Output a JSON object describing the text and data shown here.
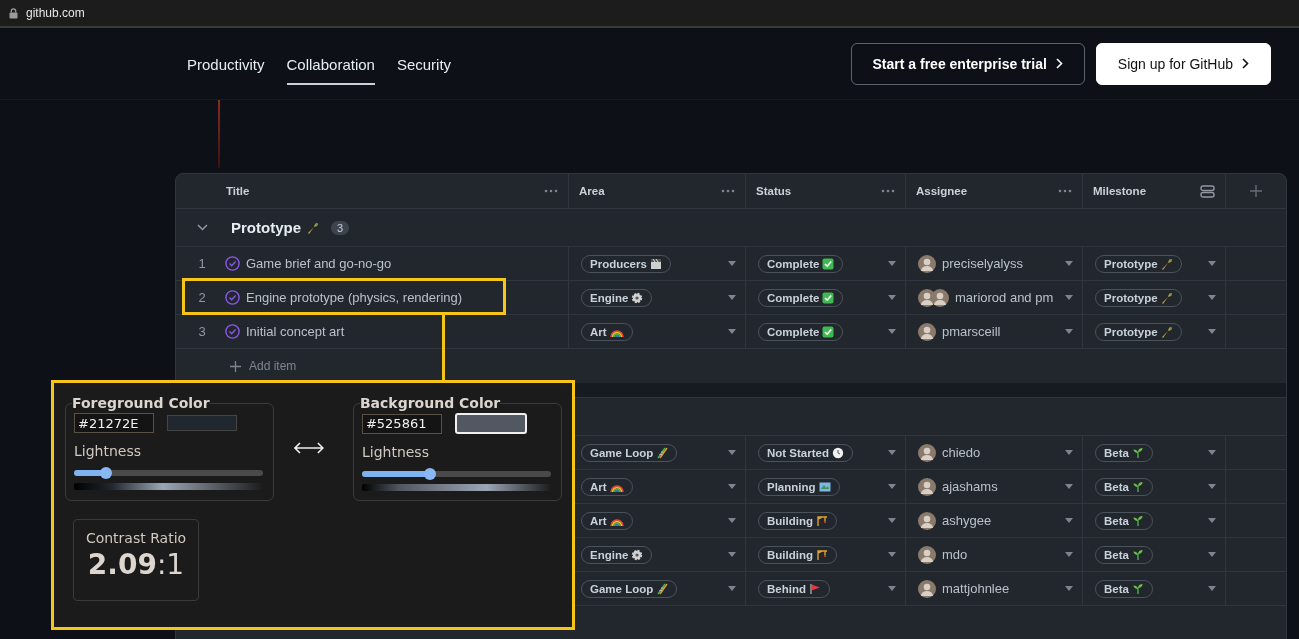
{
  "browser": {
    "address": "github.com"
  },
  "nav": {
    "links": [
      {
        "label": "Productivity",
        "selected": false
      },
      {
        "label": "Collaboration",
        "selected": true
      },
      {
        "label": "Security",
        "selected": false
      }
    ],
    "buttons": [
      {
        "label": "Start a free enterprise trial",
        "kind": "outline"
      },
      {
        "label": "Sign up for GitHub",
        "kind": "primary"
      }
    ]
  },
  "table": {
    "columns": [
      {
        "label": "Title",
        "kind": "dots"
      },
      {
        "label": "Area",
        "kind": "dots"
      },
      {
        "label": "Status",
        "kind": "dots"
      },
      {
        "label": "Assignee",
        "kind": "dots"
      },
      {
        "label": "Milestone",
        "kind": "layout"
      }
    ],
    "groups": [
      {
        "title": "Prototype",
        "kind": "bottle",
        "count": "3",
        "expanded": true,
        "add_label": "Add item",
        "rows": [
          {
            "number": "1",
            "title": "Game brief and go-no-go",
            "area": {
              "label": "Producers",
              "kind": "clapper"
            },
            "status": {
              "label": "Complete",
              "kind": "check"
            },
            "assignee": {
              "name": "preciselyalyss",
              "kind": "single"
            },
            "milestone": {
              "label": "Prototype",
              "kind": "bottle"
            }
          },
          {
            "number": "2",
            "title": "Engine prototype (physics, rendering)",
            "area": {
              "label": "Engine",
              "kind": "gear"
            },
            "status": {
              "label": "Complete",
              "kind": "check"
            },
            "assignee": {
              "name": "mariorod and pm",
              "kind": "pair"
            },
            "milestone": {
              "label": "Prototype",
              "kind": "bottle"
            }
          },
          {
            "number": "3",
            "title": "Initial concept art",
            "area": {
              "label": "Art",
              "kind": "rainbow"
            },
            "status": {
              "label": "Complete",
              "kind": "check"
            },
            "assignee": {
              "name": "pmarsceill",
              "kind": "single"
            },
            "milestone": {
              "label": "Prototype",
              "kind": "bottle"
            }
          }
        ]
      },
      {
        "rows": [
          {
            "area": {
              "label": "Game Loop",
              "kind": "slide"
            },
            "status": {
              "label": "Not Started",
              "kind": "clock"
            },
            "assignee": {
              "name": "chiedo",
              "kind": "single"
            },
            "milestone": {
              "label": "Beta",
              "kind": "sprout"
            }
          },
          {
            "area": {
              "label": "Art",
              "kind": "rainbow"
            },
            "status": {
              "label": "Planning",
              "kind": "map"
            },
            "assignee": {
              "name": "ajashams",
              "kind": "single"
            },
            "milestone": {
              "label": "Beta",
              "kind": "sprout"
            }
          },
          {
            "area": {
              "label": "Art",
              "kind": "rainbow"
            },
            "status": {
              "label": "Building",
              "kind": "crane"
            },
            "assignee": {
              "name": "ashygee",
              "kind": "single"
            },
            "milestone": {
              "label": "Beta",
              "kind": "sprout"
            }
          },
          {
            "area": {
              "label": "Engine",
              "kind": "gear"
            },
            "status": {
              "label": "Building",
              "kind": "crane"
            },
            "assignee": {
              "name": "mdo",
              "kind": "single"
            },
            "milestone": {
              "label": "Beta",
              "kind": "sprout"
            }
          },
          {
            "area": {
              "label": "Game Loop",
              "kind": "slide"
            },
            "status": {
              "label": "Behind",
              "kind": "flag"
            },
            "assignee": {
              "name": "mattjohnlee",
              "kind": "single"
            },
            "milestone": {
              "label": "Beta",
              "kind": "sprout"
            }
          }
        ]
      }
    ]
  },
  "contrast_tool": {
    "panels": [
      {
        "legend": "Foreground Color",
        "value": "#21272E",
        "color": "#21272e",
        "focused": false,
        "lightness_label": "Lightness",
        "level": 0.17
      },
      {
        "legend": "Background Color",
        "value": "#525861",
        "color": "#525861",
        "focused": true,
        "lightness_label": "Lightness",
        "level": 0.36
      }
    ],
    "contrast": {
      "label": "Contrast Ratio",
      "ratio": "**2.09**:1"
    }
  }
}
